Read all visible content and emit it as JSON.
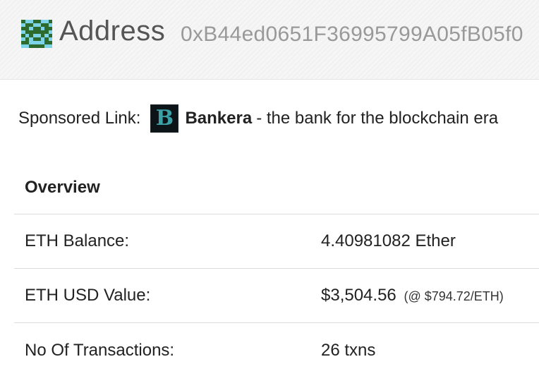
{
  "header": {
    "title": "Address",
    "address": "0xB44ed0651F36995799A05fB05f0",
    "identicon_colors": [
      "#2d6a2e",
      "#7dd3e8"
    ]
  },
  "sponsor": {
    "label": "Sponsored Link:",
    "logo_letter": "B",
    "name": "Bankera",
    "tagline": "- the bank for the blockchain era"
  },
  "overview": {
    "heading": "Overview",
    "rows": [
      {
        "label": "ETH Balance:",
        "value": "4.40981082 Ether"
      },
      {
        "label": "ETH USD Value:",
        "value": "$3,504.56",
        "extra": "(@ $794.72/ETH)"
      },
      {
        "label": "No Of Transactions:",
        "value": "26 txns"
      }
    ]
  }
}
